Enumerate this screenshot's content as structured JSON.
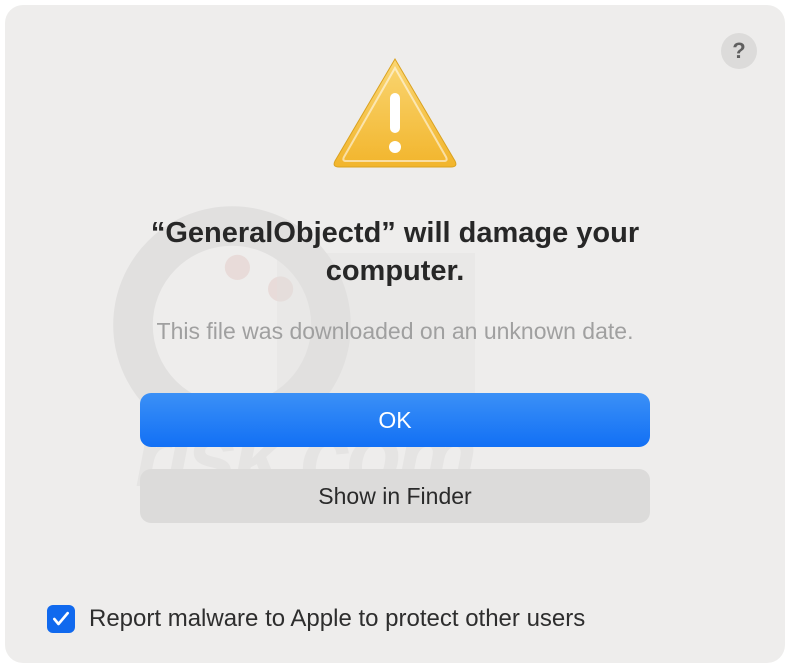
{
  "dialog": {
    "help_label": "?",
    "title": "“GeneralObjectd” will damage your computer.",
    "subtitle": "This file was downloaded on an unknown date.",
    "primary_button": "OK",
    "secondary_button": "Show in Finder",
    "checkbox_checked": true,
    "checkbox_label": "Report malware to Apple to protect other users"
  },
  "colors": {
    "dialog_bg": "#eeedec",
    "primary_button": "#1270f5",
    "secondary_button": "#dcdbda",
    "checkbox": "#1069ee",
    "text_primary": "#272727",
    "text_secondary": "#a0a0a0"
  }
}
